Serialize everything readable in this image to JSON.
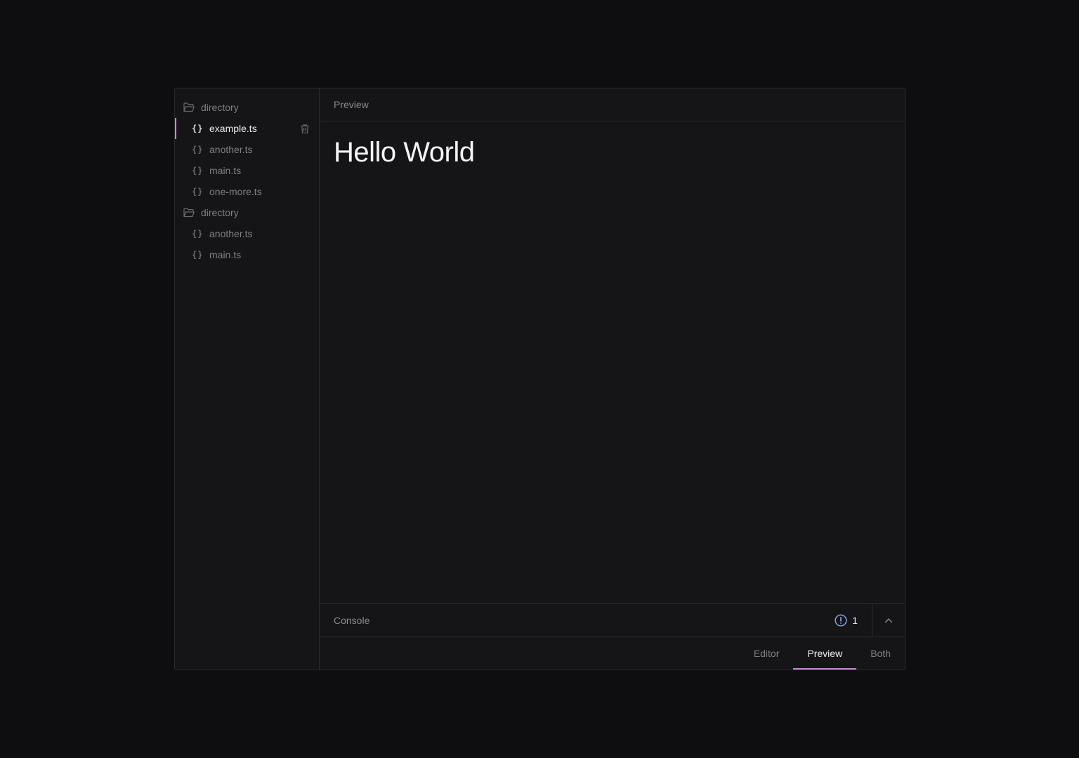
{
  "explorer": {
    "items": [
      {
        "kind": "directory",
        "label": "directory",
        "icon": "folder-open-icon"
      },
      {
        "kind": "file",
        "label": "example.ts",
        "icon": "braces-icon",
        "active": true
      },
      {
        "kind": "file",
        "label": "another.ts",
        "icon": "braces-icon"
      },
      {
        "kind": "file",
        "label": "main.ts",
        "icon": "braces-icon"
      },
      {
        "kind": "file",
        "label": "one-more.ts",
        "icon": "braces-icon"
      },
      {
        "kind": "directory",
        "label": "directory",
        "icon": "folder-open-icon"
      },
      {
        "kind": "file",
        "label": "another.ts",
        "icon": "braces-icon"
      },
      {
        "kind": "file",
        "label": "main.ts",
        "icon": "braces-icon"
      }
    ]
  },
  "preview": {
    "header": "Preview",
    "content_heading": "Hello World"
  },
  "console": {
    "label": "Console",
    "count": "1",
    "icon": "alert-circle-icon",
    "toggle_icon": "chevron-up-icon"
  },
  "view_tabs": [
    {
      "label": "Editor"
    },
    {
      "label": "Preview",
      "active": true
    },
    {
      "label": "Both"
    }
  ],
  "colors": {
    "accent": "#c58ad8",
    "info": "#8ea8f0",
    "background": "#0e0e10",
    "panel": "#151517",
    "border": "#2b2b2f"
  }
}
